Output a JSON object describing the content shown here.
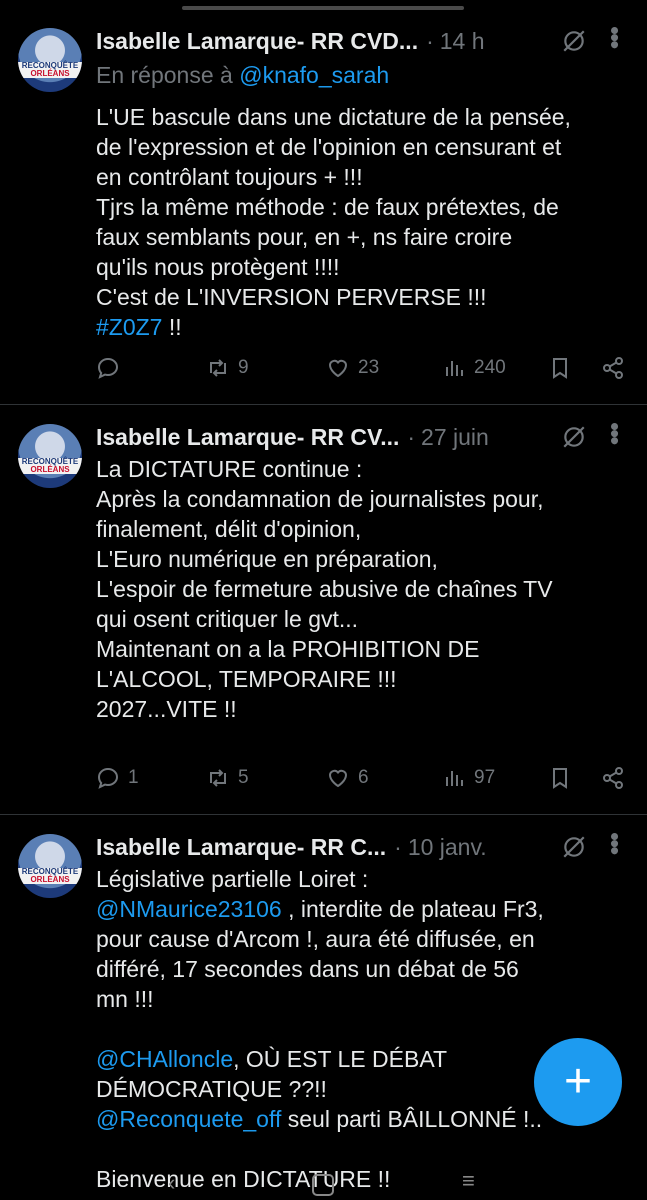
{
  "tweets": [
    {
      "author": "Isabelle Lamarque- RR CVD...",
      "separator": "·",
      "time": "14 h",
      "reply_prefix": "En réponse à ",
      "reply_to": "@knafo_sarah",
      "lines": [
        "L'UE bascule dans une dictature de la pensée,",
        "de l'expression et de l'opinion en censurant et",
        "en contrôlant toujours + !!!",
        "Tjrs la même méthode : de faux prétextes, de",
        "faux semblants pour, en +, ns faire croire",
        "qu'ils nous protègent !!!!",
        "C'est de L'INVERSION PERVERSE !!!"
      ],
      "hashtag": "#Z0Z7",
      "hashtag_suffix": " !!",
      "replies": "",
      "retweets": "9",
      "likes": "23",
      "views": "240"
    },
    {
      "author": "Isabelle Lamarque- RR CV...",
      "separator": "·",
      "time": "27 juin",
      "lines": [
        "La DICTATURE continue :",
        "Après la condamnation de journalistes pour,",
        "finalement, délit d'opinion,",
        "L'Euro numérique en préparation,",
        "L'espoir de fermeture abusive de chaînes TV",
        "qui osent critiquer le gvt...",
        "Maintenant on a la PROHIBITION DE",
        "L'ALCOOL, TEMPORAIRE !!!",
        "2027...VITE !!"
      ],
      "replies": "1",
      "retweets": "5",
      "likes": "6",
      "views": "97"
    },
    {
      "author": "Isabelle Lamarque- RR C...",
      "separator": "·",
      "time": "10 janv.",
      "line1": "Législative partielle Loiret :",
      "mention1": "@NMaurice23106",
      "text1": " , interdite de plateau Fr3,",
      "line3": "pour cause d'Arcom !, aura été diffusée, en",
      "line4": "différé, 17 secondes dans un débat de 56",
      "line5": "mn !!!",
      "mention2": "@CHAlloncle",
      "text2": ", OÙ EST LE DÉBAT",
      "line7": "DÉMOCRATIQUE ??!!",
      "mention3": "@Reconquete_off",
      "text3": " seul parti BÂILLONNÉ !..",
      "line9": "Bienvenue en DICTATURE !!"
    }
  ],
  "avatar_text": [
    "RECONQUÊTE",
    "ORLÉANS"
  ],
  "fab_label": "+",
  "colors": {
    "accent": "#1d9bf0",
    "muted": "#71767b",
    "text": "#e7e9ea",
    "bg": "#000000"
  }
}
